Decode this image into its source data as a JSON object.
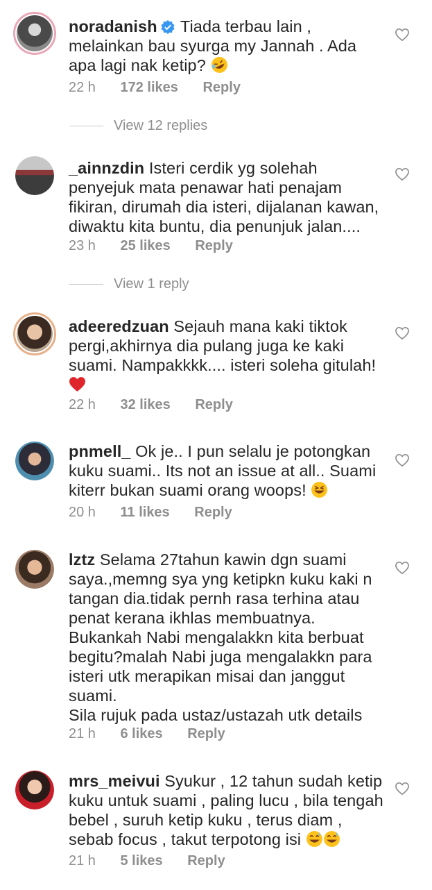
{
  "comments": [
    {
      "username": "noradanish",
      "verified": true,
      "text": "Tiada terbau lain , melainkan bau syurga my Jannah .  Ada apa lagi nak ketip?",
      "time": "22 h",
      "likes": "172 likes",
      "reply": "Reply",
      "view_replies": "View 12 replies",
      "emoji": [
        "rofl-emoji"
      ]
    },
    {
      "username": "_ainnzdin",
      "text": "Isteri cerdik yg solehah penyejuk mata penawar hati penajam fikiran, dirumah dia isteri, dijalanan kawan, diwaktu kita buntu, dia penunjuk jalan....",
      "time": "23 h",
      "likes": "25 likes",
      "reply": "Reply",
      "view_replies": "View 1 reply"
    },
    {
      "username": "adeeredzuan",
      "text": "Sejauh mana kaki tiktok pergi,akhirnya dia pulang juga ke kaki suami. Nampakkkk.... isteri soleha gitulah!",
      "time": "22 h",
      "likes": "32 likes",
      "reply": "Reply",
      "emoji": [
        "red-heart-emoji"
      ]
    },
    {
      "username": "pnmell_",
      "text": "Ok je.. I pun selalu je potongkan kuku suami.. Its not an issue at all.. Suami kiterr bukan suami orang woops!",
      "time": "20 h",
      "likes": "11 likes",
      "reply": "Reply",
      "emoji": [
        "laughing-emoji"
      ]
    },
    {
      "username": "lztz",
      "text_lines": [
        "Selama 27tahun kawin dgn suami",
        "saya.,memng sya yng ketipkn kuku kaki n",
        "tangan dia.tidak pernh rasa terhina atau",
        "penat kerana ikhlas membuatnya.",
        "Bukankah Nabi mengalakkn kita berbuat",
        "begitu?malah Nabi juga mengalakkn para",
        "isteri utk merapikan misai dan janggut",
        "suami.",
        "Sila rujuk pada ustaz/ustazah utk details"
      ],
      "time": "21 h",
      "likes": "6 likes",
      "reply": "Reply"
    },
    {
      "username": "mrs_meivui",
      "text": "Syukur , 12 tahun sudah ketip kuku untuk suami , paling lucu , bila tengah bebel , suruh ketip kuku , terus diam , sebab focus , takut terpotong isi",
      "time": "21 h",
      "likes": "5 likes",
      "reply": "Reply",
      "emoji": [
        "sweat-smile-emoji",
        "sweat-smile-emoji"
      ]
    }
  ],
  "colors": {
    "text": "#262626",
    "meta": "#8e8e8e",
    "verified": "#3897f0",
    "story_ring": "#e9a7b7"
  }
}
